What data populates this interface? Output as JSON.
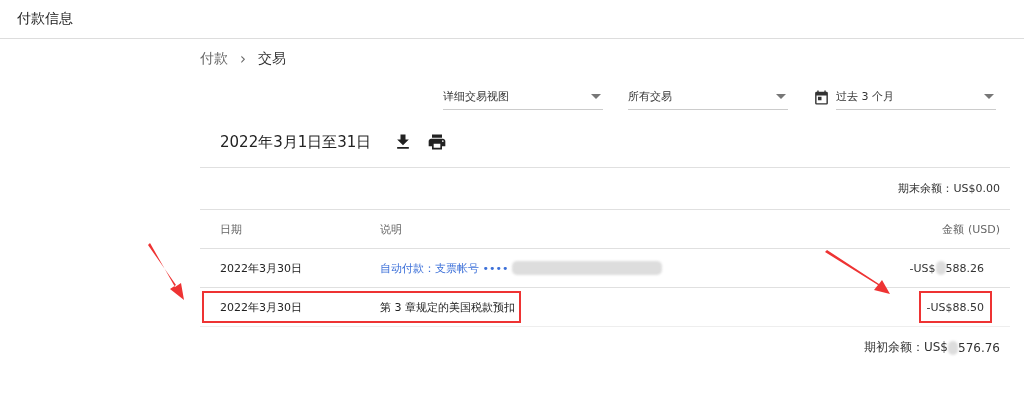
{
  "page_title": "付款信息",
  "breadcrumb": [
    {
      "label": "付款"
    },
    {
      "label": "交易"
    }
  ],
  "breadcrumb_separator": "›",
  "filters": [
    {
      "kind": "select",
      "value": "详细交易视图"
    },
    {
      "kind": "select",
      "value": "所有交易"
    },
    {
      "kind": "date",
      "value": "过去 3 个月"
    }
  ],
  "period": "2022年3月1日至31日",
  "ending_balance": {
    "label": "期末余额：",
    "amount": "US$0.00"
  },
  "table": {
    "columns": [
      "日期",
      "说明",
      "金额 (USD)"
    ],
    "rows": [
      {
        "date": "2022年3月30日",
        "description": "自动付款：支票帐号 ••••",
        "link": true,
        "amount": [
          "-US$",
          "588.26"
        ],
        "redacted": true,
        "highlighted": false
      },
      {
        "date": "2022年3月30日",
        "description": "第 3 章规定的美国税款预扣",
        "link": false,
        "amount": [
          "-US$88.50"
        ],
        "redacted": false,
        "highlighted": true
      }
    ]
  },
  "opening_balance": {
    "label": "期初余额：",
    "amount": [
      "US$",
      "576.76"
    ]
  }
}
